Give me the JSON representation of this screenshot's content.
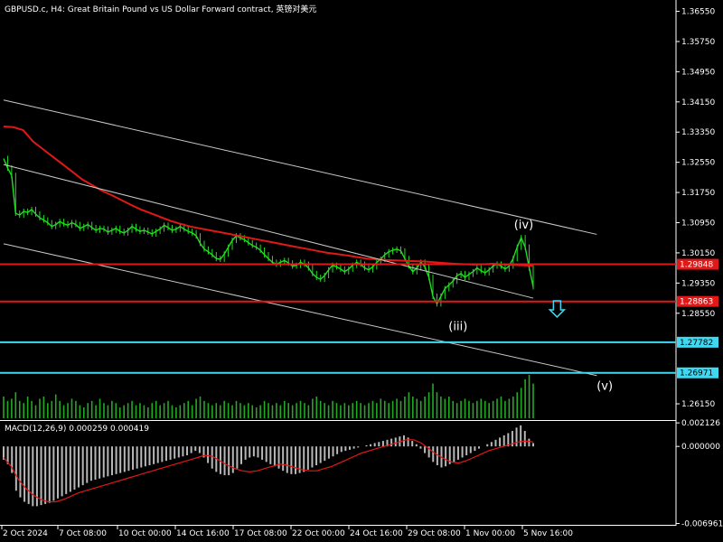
{
  "window": {
    "title": "GBPUSD.c, H4:  Great Britain Pound vs US Dollar Forward contract, 英镑对美元"
  },
  "colors": {
    "background": "#000000",
    "candle": "#22dd22",
    "ma": "#e01818",
    "level_red": "#e01818",
    "level_cyan": "#40d8f0",
    "channel": "#c8c8c8",
    "macd_hist": "#b8b8b8",
    "macd_signal": "#e01818",
    "volume": "#22aa22",
    "arrow": "#40d8f0"
  },
  "chart_data": [
    {
      "type": "line",
      "title": "GBPUSD.c, H4",
      "ylim": [
        1.2572,
        1.3685
      ],
      "y_ticks": [
        "1.36550",
        "1.35750",
        "1.34950",
        "1.34150",
        "1.33350",
        "1.32550",
        "1.31750",
        "1.30950",
        "1.30150",
        "1.29350",
        "1.28550",
        "1.26150"
      ],
      "x_ticks": [
        "2 Oct 2024",
        "7 Oct 08:00",
        "10 Oct 00:00",
        "14 Oct 16:00",
        "17 Oct 08:00",
        "22 Oct 00:00",
        "24 Oct 16:00",
        "29 Oct 08:00",
        "1 Nov 00:00",
        "5 Nov 16:00"
      ],
      "series": [
        {
          "values": [
            1.3265,
            1.324,
            1.322,
            1.312,
            1.3115,
            1.3125,
            1.3122,
            1.313,
            1.3118,
            1.3108,
            1.3102,
            1.3095,
            1.3085,
            1.309,
            1.3098,
            1.3092,
            1.3088,
            1.3095,
            1.309,
            1.308,
            1.3085,
            1.309,
            1.3082,
            1.3075,
            1.308,
            1.3078,
            1.307,
            1.3075,
            1.308,
            1.3072,
            1.3068,
            1.3075,
            1.3085,
            1.3078,
            1.3072,
            1.3075,
            1.307,
            1.3065,
            1.3072,
            1.3078,
            1.3088,
            1.3082,
            1.3075,
            1.3078,
            1.3085,
            1.3078,
            1.3072,
            1.3068,
            1.306,
            1.304,
            1.3025,
            1.3018,
            1.301,
            1.3,
            1.2998,
            1.3012,
            1.303,
            1.3048,
            1.306,
            1.3055,
            1.305,
            1.3042,
            1.3035,
            1.303,
            1.3022,
            1.301,
            1.3,
            1.299,
            1.2985,
            1.299,
            1.2995,
            1.2988,
            1.298,
            1.2982,
            1.299,
            1.2985,
            1.2975,
            1.296,
            1.295,
            1.2945,
            1.2955,
            1.297,
            1.2982,
            1.2978,
            1.2972,
            1.2965,
            1.2972,
            1.2982,
            1.299,
            1.2985,
            1.2975,
            1.297,
            1.2978,
            1.299,
            1.2998,
            1.301,
            1.3018,
            1.3022,
            1.3025,
            1.302,
            1.3,
            1.298,
            1.2965,
            1.2975,
            1.299,
            1.2978,
            1.295,
            1.29,
            1.288,
            1.29,
            1.292,
            1.293,
            1.294,
            1.2955,
            1.296,
            1.295,
            1.2958,
            1.2965,
            1.2975,
            1.2968,
            1.2962,
            1.297,
            1.298,
            1.2985,
            1.298,
            1.2972,
            1.298,
            1.3,
            1.303,
            1.3055,
            1.303,
            1.2975,
            1.2925
          ]
        },
        {
          "name": "MA",
          "values": [
            1.335,
            1.3348,
            1.334,
            1.331,
            1.329,
            1.327,
            1.325,
            1.323,
            1.321,
            1.3195,
            1.318,
            1.3168,
            1.3155,
            1.3142,
            1.313,
            1.312,
            1.311,
            1.31,
            1.3092,
            1.3085,
            1.308,
            1.3075,
            1.307,
            1.3065,
            1.306,
            1.3055,
            1.305,
            1.3045,
            1.304,
            1.3035,
            1.303,
            1.3025,
            1.302,
            1.3015,
            1.3012,
            1.3008,
            1.3004,
            1.3,
            1.2998,
            1.2996,
            1.2995,
            1.2994,
            1.2993,
            1.2992,
            1.299,
            1.2988,
            1.2986,
            1.2985,
            1.2984,
            1.2985,
            1.2986,
            1.2984,
            1.2983,
            1.2982,
            1.2981
          ]
        }
      ],
      "levels": [
        {
          "value": 1.29848,
          "label": "1.29848",
          "style": "red"
        },
        {
          "value": 1.28863,
          "label": "1.28863",
          "style": "red"
        },
        {
          "value": 1.27782,
          "label": "1.27782",
          "style": "cyan"
        },
        {
          "value": 1.26971,
          "label": "1.26971",
          "style": "cyan"
        }
      ],
      "channel_lines": [
        {
          "x": [
            0,
            1.12
          ],
          "y": [
            1.342,
            1.3064
          ]
        },
        {
          "x": [
            0,
            1.0
          ],
          "y": [
            1.3249,
            1.2895
          ]
        },
        {
          "x": [
            0,
            1.12
          ],
          "y": [
            1.3039,
            1.269
          ]
        }
      ],
      "annotations": [
        {
          "text": "(iv)",
          "x": 0.982,
          "y": 1.308
        },
        {
          "text": "(iii)",
          "x": 0.858,
          "y": 1.281
        },
        {
          "text": "(v)",
          "x": 1.135,
          "y": 1.2652
        }
      ],
      "arrow": {
        "x": 1.045,
        "y_top": 1.2888,
        "y_bottom": 1.2845
      },
      "volume": [
        0.5,
        0.4,
        0.45,
        0.6,
        0.4,
        0.35,
        0.5,
        0.4,
        0.3,
        0.45,
        0.5,
        0.35,
        0.4,
        0.55,
        0.4,
        0.3,
        0.35,
        0.45,
        0.4,
        0.3,
        0.25,
        0.35,
        0.4,
        0.3,
        0.45,
        0.35,
        0.3,
        0.4,
        0.35,
        0.25,
        0.3,
        0.35,
        0.4,
        0.3,
        0.35,
        0.3,
        0.25,
        0.35,
        0.4,
        0.3,
        0.35,
        0.4,
        0.3,
        0.25,
        0.3,
        0.35,
        0.4,
        0.3,
        0.45,
        0.5,
        0.4,
        0.35,
        0.3,
        0.35,
        0.3,
        0.4,
        0.35,
        0.3,
        0.4,
        0.35,
        0.3,
        0.35,
        0.3,
        0.25,
        0.3,
        0.4,
        0.35,
        0.3,
        0.35,
        0.3,
        0.4,
        0.35,
        0.3,
        0.35,
        0.4,
        0.35,
        0.3,
        0.45,
        0.5,
        0.4,
        0.35,
        0.3,
        0.4,
        0.35,
        0.3,
        0.35,
        0.3,
        0.35,
        0.4,
        0.35,
        0.3,
        0.35,
        0.4,
        0.35,
        0.45,
        0.4,
        0.35,
        0.4,
        0.45,
        0.4,
        0.5,
        0.6,
        0.5,
        0.45,
        0.4,
        0.5,
        0.6,
        0.8,
        0.6,
        0.5,
        0.45,
        0.5,
        0.4,
        0.35,
        0.4,
        0.45,
        0.4,
        0.35,
        0.4,
        0.45,
        0.4,
        0.35,
        0.4,
        0.45,
        0.5,
        0.4,
        0.45,
        0.5,
        0.6,
        0.7,
        0.9,
        1.0,
        0.8
      ]
    },
    {
      "type": "bar",
      "title": "MACD(12,26,9) 0.000259 0.000419",
      "ylim": [
        -0.007,
        0.0023
      ],
      "y_ticks": [
        "0.002126",
        "0.000000",
        "-0.006961"
      ],
      "series": [
        {
          "name": "MACD",
          "values": [
            -0.0012,
            -0.0016,
            -0.0024,
            -0.004,
            -0.0046,
            -0.005,
            -0.0052,
            -0.0054,
            -0.0054,
            -0.0053,
            -0.0052,
            -0.0051,
            -0.0049,
            -0.0047,
            -0.0045,
            -0.0043,
            -0.0041,
            -0.0039,
            -0.0037,
            -0.0035,
            -0.0033,
            -0.0031,
            -0.003,
            -0.0029,
            -0.0028,
            -0.0027,
            -0.0026,
            -0.0025,
            -0.0024,
            -0.0023,
            -0.0022,
            -0.0021,
            -0.002,
            -0.0019,
            -0.0018,
            -0.0017,
            -0.0016,
            -0.0015,
            -0.0014,
            -0.0013,
            -0.0012,
            -0.0011,
            -0.001,
            -0.0009,
            -0.0008,
            -0.0006,
            -0.0004,
            -0.0006,
            -0.001,
            -0.0015,
            -0.002,
            -0.0023,
            -0.0025,
            -0.0026,
            -0.0026,
            -0.0024,
            -0.002,
            -0.0016,
            -0.0012,
            -0.001,
            -0.0009,
            -0.001,
            -0.0012,
            -0.0014,
            -0.0016,
            -0.0018,
            -0.002,
            -0.0022,
            -0.0024,
            -0.0025,
            -0.0025,
            -0.0024,
            -0.0023,
            -0.0021,
            -0.0019,
            -0.0017,
            -0.0015,
            -0.0013,
            -0.0011,
            -0.0009,
            -0.0007,
            -0.0005,
            -0.0004,
            -0.0003,
            -0.0002,
            -0.0001,
            0.0,
            0.0001,
            0.0002,
            0.0003,
            0.0004,
            0.0005,
            0.0006,
            0.0007,
            0.0008,
            0.0009,
            0.001,
            0.0008,
            0.0005,
            0.0002,
            -0.0002,
            -0.0006,
            -0.001,
            -0.0014,
            -0.0017,
            -0.0019,
            -0.0018,
            -0.0016,
            -0.0014,
            -0.0012,
            -0.001,
            -0.0008,
            -0.0006,
            -0.0004,
            -0.0002,
            0.0,
            0.0002,
            0.0004,
            0.0006,
            0.0008,
            0.001,
            0.0012,
            0.0014,
            0.0017,
            0.0019,
            0.0014,
            0.0007,
            0.0003
          ]
        },
        {
          "name": "Signal",
          "values": [
            -0.001,
            -0.0018,
            -0.003,
            -0.0038,
            -0.0044,
            -0.0048,
            -0.005,
            -0.005,
            -0.0048,
            -0.0045,
            -0.0042,
            -0.004,
            -0.0038,
            -0.0036,
            -0.0034,
            -0.0032,
            -0.003,
            -0.0028,
            -0.0026,
            -0.0024,
            -0.0022,
            -0.002,
            -0.0018,
            -0.0016,
            -0.0014,
            -0.0012,
            -0.001,
            -0.0008,
            -0.0009,
            -0.0013,
            -0.0017,
            -0.002,
            -0.0022,
            -0.0023,
            -0.0022,
            -0.002,
            -0.0018,
            -0.0016,
            -0.0017,
            -0.0019,
            -0.0021,
            -0.0022,
            -0.0022,
            -0.002,
            -0.0018,
            -0.0015,
            -0.0012,
            -0.0009,
            -0.0006,
            -0.0004,
            -0.0002,
            0.0,
            0.0002,
            0.0004,
            0.0006,
            0.0006,
            0.0003,
            -0.0002,
            -0.0007,
            -0.0011,
            -0.0014,
            -0.0015,
            -0.0013,
            -0.001,
            -0.0007,
            -0.0004,
            -0.0002,
            0.0,
            0.0002,
            0.0004,
            0.0005,
            0.0004
          ]
        }
      ]
    }
  ]
}
